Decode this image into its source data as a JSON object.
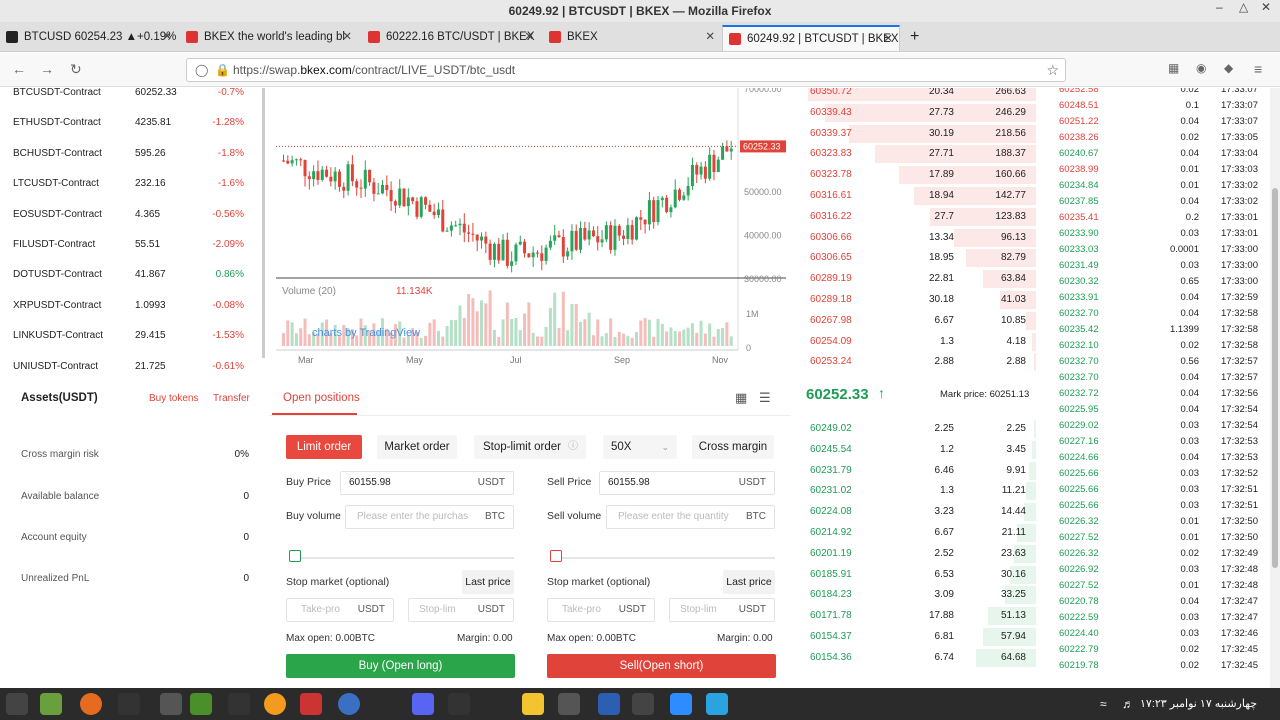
{
  "window": {
    "title": "60249.92 | BTCUSDT | BKEX — Mozilla Firefox"
  },
  "tabs": [
    {
      "label": "BTCUSD 60254.23 ▲+0.19%"
    },
    {
      "label": "BKEX the world's leading bl"
    },
    {
      "label": "60222.16 BTC/USDT | BKEX"
    },
    {
      "label": "BKEX"
    },
    {
      "label": "60249.92 | BTCUSDT | BKEX"
    }
  ],
  "url": {
    "prefix": "https://swap.",
    "domain": "bkex.com",
    "path": "/contract/LIVE_USDT/btc_usdt"
  },
  "markets": [
    {
      "name": "BTCUSDT-Contract",
      "price": "60252.33",
      "change": "-0.7%",
      "dir": "neg"
    },
    {
      "name": "ETHUSDT-Contract",
      "price": "4235.81",
      "change": "-1.28%",
      "dir": "neg"
    },
    {
      "name": "BCHUSDT-Contract",
      "price": "595.26",
      "change": "-1.8%",
      "dir": "neg"
    },
    {
      "name": "LTCUSDT-Contract",
      "price": "232.16",
      "change": "-1.6%",
      "dir": "neg"
    },
    {
      "name": "EOSUSDT-Contract",
      "price": "4.365",
      "change": "-0.56%",
      "dir": "neg"
    },
    {
      "name": "FILUSDT-Contract",
      "price": "55.51",
      "change": "-2.09%",
      "dir": "neg"
    },
    {
      "name": "DOTUSDT-Contract",
      "price": "41.867",
      "change": "0.86%",
      "dir": "pos"
    },
    {
      "name": "XRPUSDT-Contract",
      "price": "1.0993",
      "change": "-0.08%",
      "dir": "neg"
    },
    {
      "name": "LINKUSDT-Contract",
      "price": "29.415",
      "change": "-1.53%",
      "dir": "neg"
    },
    {
      "name": "UNIUSDT-Contract",
      "price": "21.725",
      "change": "-0.61%",
      "dir": "neg"
    }
  ],
  "chart": {
    "price_label": "60252.33",
    "y_ticks": [
      "70000.00",
      "50000.00",
      "40000.00",
      "30000.00"
    ],
    "x_ticks": [
      "Mar",
      "May",
      "Jul",
      "Sep",
      "Nov"
    ],
    "volume_label": "Volume (20)",
    "volume_value": "11.134K",
    "vol_ticks": [
      "1M",
      "0"
    ],
    "watermark": "charts by TradingView"
  },
  "chart_data": {
    "type": "line",
    "title": "",
    "x": [
      "Mar",
      "May",
      "Jul",
      "Sep",
      "Nov"
    ],
    "ylim": [
      30000,
      70000
    ],
    "series": [
      {
        "values": [
          57000,
          50000,
          35000,
          40000,
          60252
        ]
      }
    ],
    "last_price": 60252.33
  },
  "assets": {
    "title": "Assets(USDT)",
    "buy_tokens": "Buy tokens",
    "transfer": "Transfer",
    "rows": [
      {
        "label": "Cross margin risk",
        "value": "0%"
      },
      {
        "label": "Available balance",
        "value": "0"
      },
      {
        "label": "Account equity",
        "value": "0"
      },
      {
        "label": "Unrealized PnL",
        "value": "0"
      }
    ]
  },
  "trade": {
    "tab_open": "Open positions",
    "limit": "Limit order",
    "market": "Market order",
    "stoplimit": "Stop-limit order",
    "leverage": "50X",
    "margin_mode": "Cross margin",
    "buy_price_label": "Buy Price",
    "buy_price": "60155.98",
    "sell_price_label": "Sell Price",
    "sell_price": "60155.98",
    "unit_usdt": "USDT",
    "unit_btc": "BTC",
    "buy_volume_label": "Buy volume",
    "sell_volume_label": "Sell volume",
    "buy_vol_ph": "Please enter the purchas",
    "sell_vol_ph": "Please enter the quantity",
    "stop_label": "Stop market (optional)",
    "last_price": "Last price",
    "take_ph": "Take-pro",
    "stop_ph": "Stop-lim",
    "max_open": "Max open: 0.00BTC",
    "margin": "Margin: 0.00",
    "buy_btn": "Buy (Open long)",
    "sell_btn": "Sell(Open short)"
  },
  "asks": [
    {
      "p": "60350.72",
      "a": "20.34",
      "t": "266.63",
      "f": 0.95
    },
    {
      "p": "60339.43",
      "a": "27.73",
      "t": "246.29",
      "f": 0.88
    },
    {
      "p": "60339.37",
      "a": "30.19",
      "t": "218.56",
      "f": 0.78
    },
    {
      "p": "60323.83",
      "a": "27.71",
      "t": "188.37",
      "f": 0.67
    },
    {
      "p": "60323.78",
      "a": "17.89",
      "t": "160.66",
      "f": 0.57
    },
    {
      "p": "60316.61",
      "a": "18.94",
      "t": "142.77",
      "f": 0.51
    },
    {
      "p": "60316.22",
      "a": "27.7",
      "t": "123.83",
      "f": 0.44
    },
    {
      "p": "60306.66",
      "a": "13.34",
      "t": "96.13",
      "f": 0.34
    },
    {
      "p": "60306.65",
      "a": "18.95",
      "t": "82.79",
      "f": 0.29
    },
    {
      "p": "60289.19",
      "a": "22.81",
      "t": "63.84",
      "f": 0.22
    },
    {
      "p": "60289.18",
      "a": "30.18",
      "t": "41.03",
      "f": 0.15
    },
    {
      "p": "60267.98",
      "a": "6.67",
      "t": "10.85",
      "f": 0.04
    },
    {
      "p": "60254.09",
      "a": "1.3",
      "t": "4.18",
      "f": 0.015
    },
    {
      "p": "60253.24",
      "a": "2.88",
      "t": "2.88",
      "f": 0.01
    }
  ],
  "mid": {
    "price": "60252.33",
    "mark": "Mark price: 60251.13"
  },
  "bids": [
    {
      "p": "60249.02",
      "a": "2.25",
      "t": "2.25",
      "f": 0.01
    },
    {
      "p": "60245.54",
      "a": "1.2",
      "t": "3.45",
      "f": 0.015
    },
    {
      "p": "60231.79",
      "a": "6.46",
      "t": "9.91",
      "f": 0.03
    },
    {
      "p": "60231.02",
      "a": "1.3",
      "t": "11.21",
      "f": 0.04
    },
    {
      "p": "60224.08",
      "a": "3.23",
      "t": "14.44",
      "f": 0.05
    },
    {
      "p": "60214.92",
      "a": "6.67",
      "t": "21.11",
      "f": 0.08
    },
    {
      "p": "60201.19",
      "a": "2.52",
      "t": "23.63",
      "f": 0.09
    },
    {
      "p": "60185.91",
      "a": "6.53",
      "t": "30.16",
      "f": 0.11
    },
    {
      "p": "60184.23",
      "a": "3.09",
      "t": "33.25",
      "f": 0.13
    },
    {
      "p": "60171.78",
      "a": "17.88",
      "t": "51.13",
      "f": 0.2
    },
    {
      "p": "60154.37",
      "a": "6.81",
      "t": "57.94",
      "f": 0.22
    },
    {
      "p": "60154.36",
      "a": "6.74",
      "t": "64.68",
      "f": 0.25
    }
  ],
  "trades": [
    {
      "p": "60252.58",
      "a": "0.02",
      "t": "17:33:07",
      "d": "neg"
    },
    {
      "p": "60248.51",
      "a": "0.1",
      "t": "17:33:07",
      "d": "neg"
    },
    {
      "p": "60251.22",
      "a": "0.04",
      "t": "17:33:07",
      "d": "neg"
    },
    {
      "p": "60238.26",
      "a": "0.02",
      "t": "17:33:05",
      "d": "neg"
    },
    {
      "p": "60240.67",
      "a": "0.04",
      "t": "17:33:04",
      "d": "pos"
    },
    {
      "p": "60238.99",
      "a": "0.01",
      "t": "17:33:03",
      "d": "neg"
    },
    {
      "p": "60234.84",
      "a": "0.01",
      "t": "17:33:02",
      "d": "pos"
    },
    {
      "p": "60237.85",
      "a": "0.04",
      "t": "17:33:02",
      "d": "pos"
    },
    {
      "p": "60235.41",
      "a": "0.2",
      "t": "17:33:01",
      "d": "neg"
    },
    {
      "p": "60233.90",
      "a": "0.03",
      "t": "17:33:01",
      "d": "pos"
    },
    {
      "p": "60233.03",
      "a": "0.0001",
      "t": "17:33:00",
      "d": "pos"
    },
    {
      "p": "60231.49",
      "a": "0.03",
      "t": "17:33:00",
      "d": "pos"
    },
    {
      "p": "60230.32",
      "a": "0.65",
      "t": "17:33:00",
      "d": "pos"
    },
    {
      "p": "60233.91",
      "a": "0.04",
      "t": "17:32:59",
      "d": "pos"
    },
    {
      "p": "60232.70",
      "a": "0.04",
      "t": "17:32:58",
      "d": "pos"
    },
    {
      "p": "60235.42",
      "a": "1.1399",
      "t": "17:32:58",
      "d": "pos"
    },
    {
      "p": "60232.10",
      "a": "0.02",
      "t": "17:32:58",
      "d": "pos"
    },
    {
      "p": "60232.70",
      "a": "0.56",
      "t": "17:32:57",
      "d": "pos"
    },
    {
      "p": "60232.70",
      "a": "0.04",
      "t": "17:32:57",
      "d": "pos"
    },
    {
      "p": "60232.72",
      "a": "0.04",
      "t": "17:32:56",
      "d": "pos"
    },
    {
      "p": "60225.95",
      "a": "0.04",
      "t": "17:32:54",
      "d": "pos"
    },
    {
      "p": "60229.02",
      "a": "0.03",
      "t": "17:32:54",
      "d": "pos"
    },
    {
      "p": "60227.16",
      "a": "0.03",
      "t": "17:32:53",
      "d": "pos"
    },
    {
      "p": "60224.66",
      "a": "0.04",
      "t": "17:32:53",
      "d": "pos"
    },
    {
      "p": "60225.66",
      "a": "0.03",
      "t": "17:32:52",
      "d": "pos"
    },
    {
      "p": "60225.66",
      "a": "0.03",
      "t": "17:32:51",
      "d": "pos"
    },
    {
      "p": "60225.66",
      "a": "0.03",
      "t": "17:32:51",
      "d": "pos"
    },
    {
      "p": "60226.32",
      "a": "0.01",
      "t": "17:32:50",
      "d": "pos"
    },
    {
      "p": "60227.52",
      "a": "0.01",
      "t": "17:32:50",
      "d": "pos"
    },
    {
      "p": "60226.32",
      "a": "0.02",
      "t": "17:32:49",
      "d": "pos"
    },
    {
      "p": "60226.92",
      "a": "0.03",
      "t": "17:32:48",
      "d": "pos"
    },
    {
      "p": "60227.52",
      "a": "0.01",
      "t": "17:32:48",
      "d": "pos"
    },
    {
      "p": "60220.78",
      "a": "0.04",
      "t": "17:32:47",
      "d": "pos"
    },
    {
      "p": "60222.59",
      "a": "0.03",
      "t": "17:32:47",
      "d": "pos"
    },
    {
      "p": "60224.40",
      "a": "0.03",
      "t": "17:32:46",
      "d": "pos"
    },
    {
      "p": "60222.79",
      "a": "0.02",
      "t": "17:32:45",
      "d": "pos"
    },
    {
      "p": "60219.78",
      "a": "0.02",
      "t": "17:32:45",
      "d": "pos"
    }
  ],
  "taskbar": {
    "clock": "چهارشنبه ۱۷ نوامبر ۱۷:۲۳"
  },
  "colors": {
    "red": "#e0433a",
    "green": "#1f9d55",
    "ask_bg": "#fde8e8",
    "bid_bg": "#e6f6ec"
  }
}
